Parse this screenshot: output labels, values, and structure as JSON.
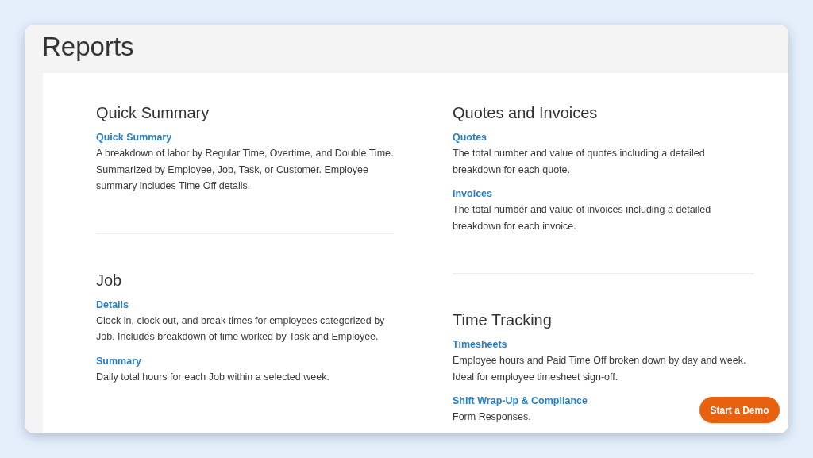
{
  "page_title": "Reports",
  "columns": [
    [
      {
        "title": "Quick Summary",
        "reports": [
          {
            "name": "Quick Summary",
            "description": "A breakdown of labor by Regular Time, Overtime, and Double Time. Summarized by Employee, Job, Task, or Customer. Employee summary includes Time Off details."
          }
        ]
      },
      {
        "title": "Job",
        "reports": [
          {
            "name": "Details",
            "description": "Clock in, clock out, and break times for employees categorized by Job. Includes breakdown of time worked by Task and Employee."
          },
          {
            "name": "Summary",
            "description": "Daily total hours for each Job within a selected week."
          }
        ]
      }
    ],
    [
      {
        "title": "Quotes and Invoices",
        "reports": [
          {
            "name": "Quotes",
            "description": "The total number and value of quotes including a detailed breakdown for each quote."
          },
          {
            "name": "Invoices",
            "description": "The total number and value of invoices including a detailed breakdown for each invoice."
          }
        ]
      },
      {
        "title": "Time Tracking",
        "reports": [
          {
            "name": "Timesheets",
            "description": "Employee hours and Paid Time Off broken down by day and week. Ideal for employee timesheet sign-off."
          },
          {
            "name": "Shift Wrap-Up & Compliance",
            "description": "Form Responses."
          }
        ]
      }
    ]
  ],
  "demo_button": "Start a Demo"
}
